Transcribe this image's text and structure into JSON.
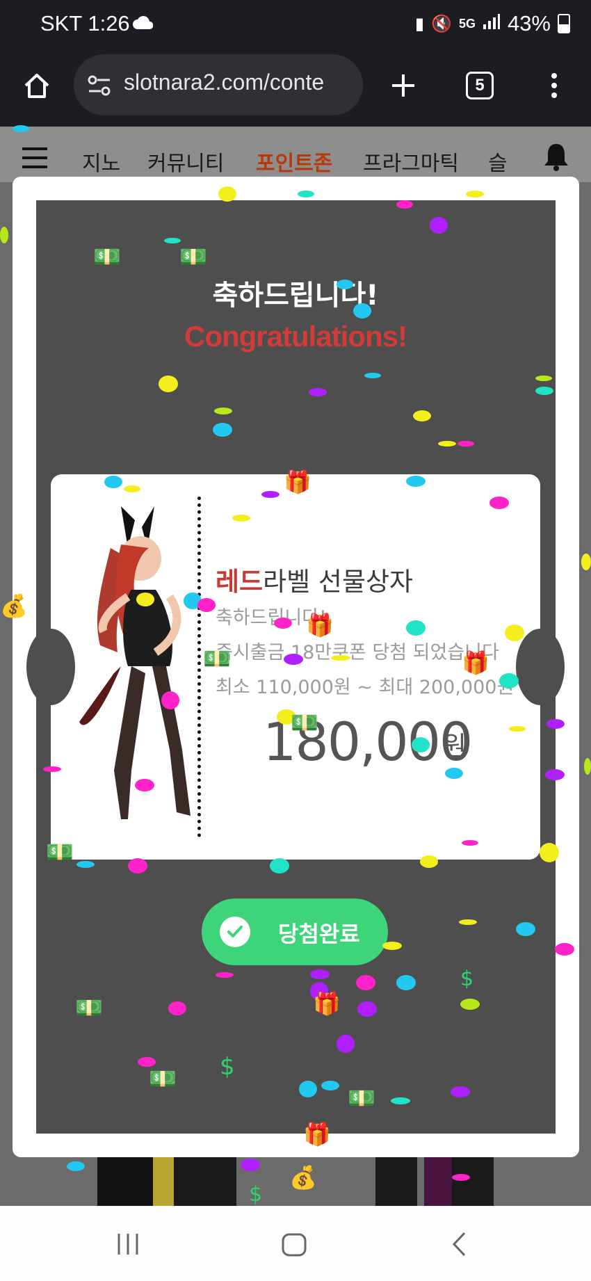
{
  "status_bar": {
    "carrier_time": "SKT 1:26",
    "network": "5G",
    "battery": "43%"
  },
  "browser": {
    "url": "slotnara2.com/conte",
    "tab_count": "5"
  },
  "site_nav": {
    "items": [
      "지노",
      "커뮤니티",
      "포인트존",
      "프라그마틱",
      "슬"
    ],
    "active_index": 2
  },
  "modal": {
    "title_ko": "축하드립니다!",
    "title_en": "Congratulations!",
    "ticket": {
      "title_highlight": "레드",
      "title_rest": "라벨 선물상자",
      "line1": "축하드립니다!",
      "line2": "즉시출금 18만쿠폰 당첨 되었습니다",
      "line3": "최소 110,000원 ~ 최대 200,000원",
      "amount": "180,000",
      "amount_unit": "원"
    },
    "button_label": "당첨완료"
  },
  "colors": {
    "accent_red": "#c73a36",
    "button_green": "#3ed47a",
    "panel": "#4e4e4f"
  }
}
